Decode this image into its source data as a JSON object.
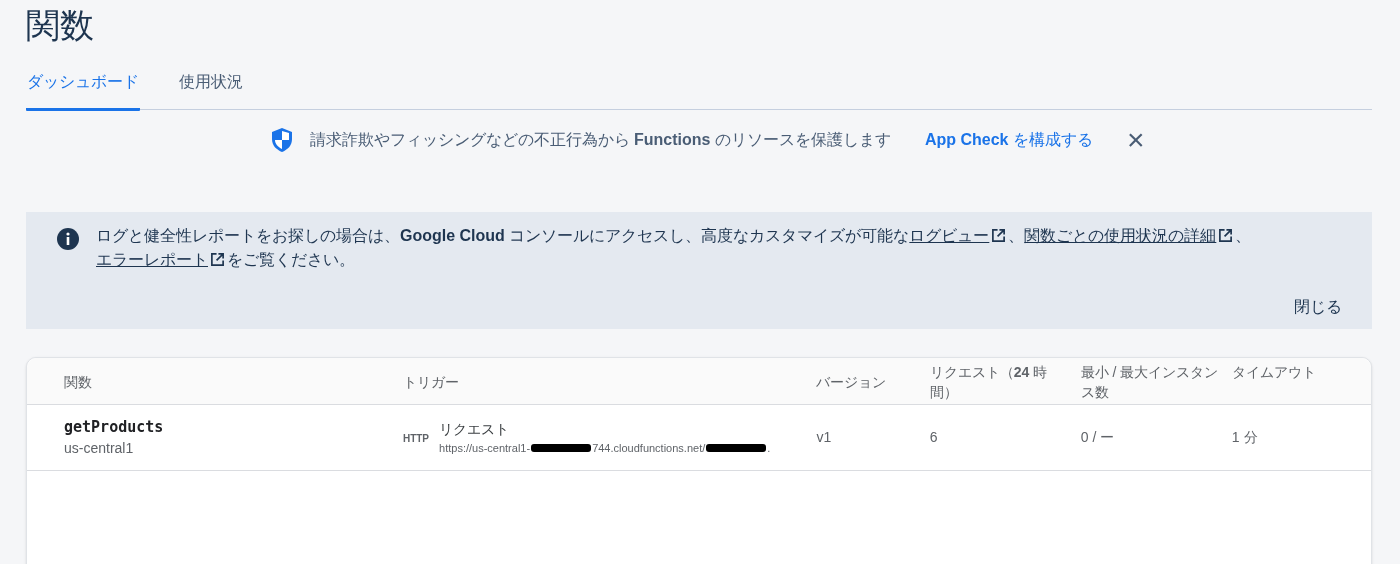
{
  "page_title": "関数",
  "tabs": [
    {
      "label": "ダッシュボード",
      "selected": true
    },
    {
      "label": "使用状況",
      "selected": false
    }
  ],
  "app_check_banner": {
    "text": "請求詐欺やフィッシングなどの不正行為から **Functions** のリソースを保護します",
    "link": "**App Check** を構成する",
    "close": "×"
  },
  "info_banner": {
    "parts": [
      {
        "kind": "text",
        "text": "ログと健全性レポートをお探しの場合は、**Google Cloud** コンソールにアクセスし、高度なカスタマイズが可能な"
      },
      {
        "kind": "link",
        "text": "ログビュー"
      },
      {
        "kind": "text",
        "text": "、"
      },
      {
        "kind": "link",
        "text": "関数ごとの使用状況の詳細"
      },
      {
        "kind": "text",
        "text": "、"
      },
      {
        "kind": "link",
        "text": "エラーレポート"
      },
      {
        "kind": "text",
        "text": "をご覧ください。"
      }
    ],
    "dismiss": "閉じる"
  },
  "table": {
    "columns": [
      "関数",
      "トリガー",
      "バージョン",
      "リクエスト（**24** 時間）",
      "最小 / 最大インスタンス数",
      "タイムアウト"
    ],
    "rows": [
      {
        "name": "getProducts",
        "region": "us-central1",
        "trigger_badge": "HTTP",
        "trigger": "リクエスト",
        "url_parts": [
          {
            "kind": "text",
            "text": "https://us-central1-"
          },
          {
            "kind": "redacted"
          },
          {
            "kind": "text",
            "text": "744.cloudfunctions.net/"
          },
          {
            "kind": "redacted"
          },
          {
            "kind": "text",
            "text": "."
          }
        ],
        "version": "v1",
        "requests": "6",
        "instances": "0 / ー",
        "timeout": "1 分"
      }
    ]
  }
}
